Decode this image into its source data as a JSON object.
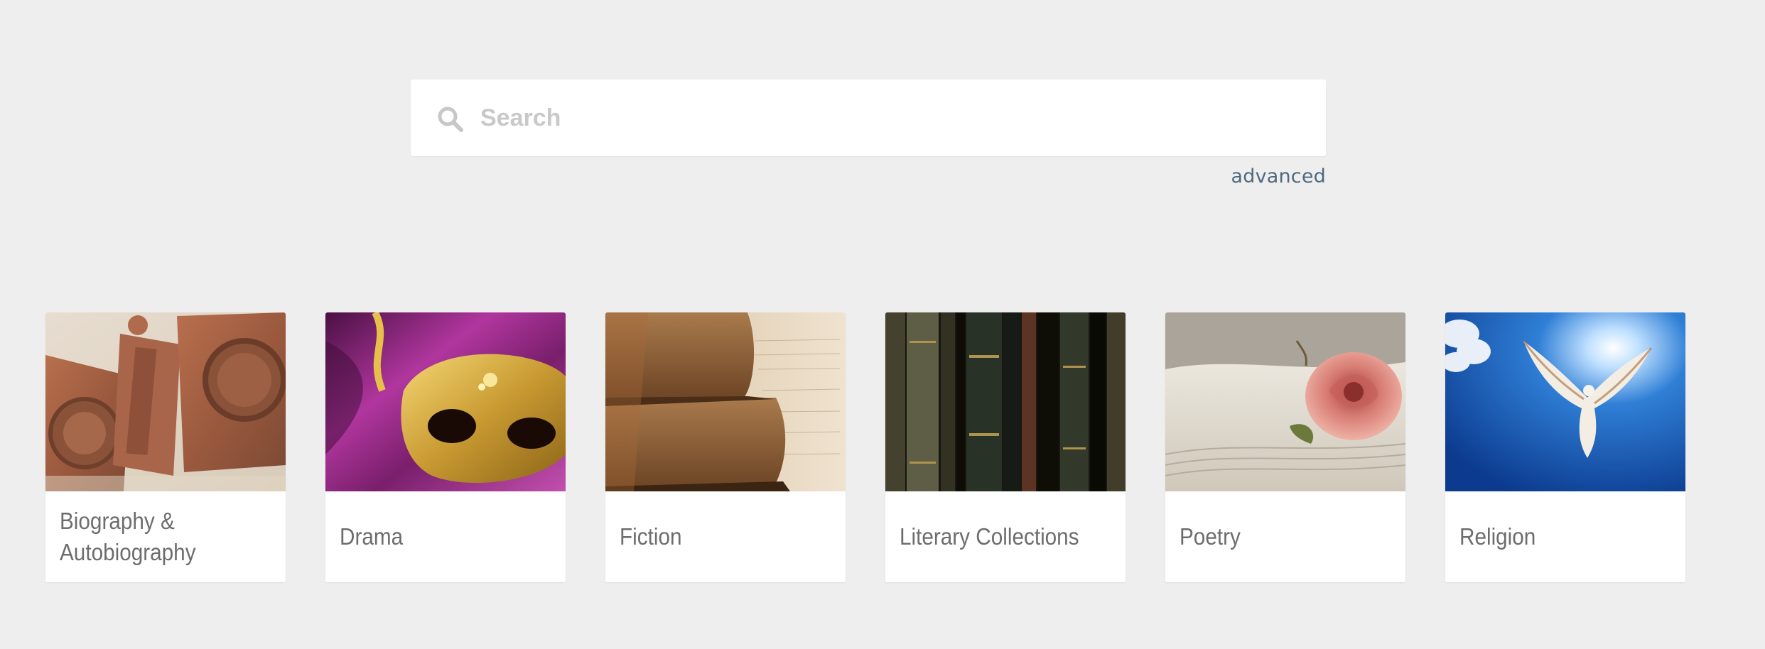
{
  "search": {
    "placeholder": "Search",
    "advanced_label": "advanced"
  },
  "categories": [
    {
      "label": "Biography & Autobiography",
      "image": "biography-letterpress-image"
    },
    {
      "label": "Drama",
      "image": "drama-gold-mask-image"
    },
    {
      "label": "Fiction",
      "image": "fiction-old-books-image"
    },
    {
      "label": "Literary Collections",
      "image": "literary-collections-bookshelf-image"
    },
    {
      "label": "Poetry",
      "image": "poetry-rose-on-book-image"
    },
    {
      "label": "Religion",
      "image": "religion-dove-sky-image"
    }
  ],
  "colors": {
    "background": "#eeeeee",
    "card": "#ffffff",
    "link": "#4e6a80",
    "label_text": "#6d6d6d",
    "placeholder": "#c9c9c9"
  }
}
